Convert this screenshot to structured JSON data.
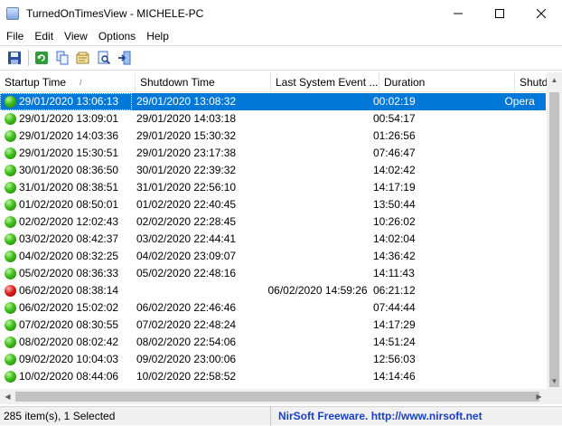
{
  "window": {
    "title": "TurnedOnTimesView  -  MICHELE-PC"
  },
  "menu": [
    "File",
    "Edit",
    "View",
    "Options",
    "Help"
  ],
  "toolbar": {
    "buttons": [
      {
        "name": "save-icon"
      },
      {
        "name": "refresh-icon"
      },
      {
        "name": "copy-icon"
      },
      {
        "name": "properties-icon"
      },
      {
        "name": "find-icon"
      },
      {
        "name": "exit-icon"
      }
    ]
  },
  "columns": [
    "Startup Time",
    "Shutdown Time",
    "Last System Event ...",
    "Duration",
    "Shutdown"
  ],
  "sort_indicator": "/",
  "rows": [
    {
      "startup": "29/01/2020 13:06:13",
      "shutdown": "29/01/2020 13:08:32",
      "event": "",
      "duration": "00:02:19",
      "extra": "Opera",
      "status": "selected"
    },
    {
      "startup": "29/01/2020 13:09:01",
      "shutdown": "29/01/2020 14:03:18",
      "event": "",
      "duration": "00:54:17",
      "extra": "",
      "status": "green"
    },
    {
      "startup": "29/01/2020 14:03:36",
      "shutdown": "29/01/2020 15:30:32",
      "event": "",
      "duration": "01:26:56",
      "extra": "",
      "status": "green"
    },
    {
      "startup": "29/01/2020 15:30:51",
      "shutdown": "29/01/2020 23:17:38",
      "event": "",
      "duration": "07:46:47",
      "extra": "",
      "status": "green"
    },
    {
      "startup": "30/01/2020 08:36:50",
      "shutdown": "30/01/2020 22:39:32",
      "event": "",
      "duration": "14:02:42",
      "extra": "",
      "status": "green"
    },
    {
      "startup": "31/01/2020 08:38:51",
      "shutdown": "31/01/2020 22:56:10",
      "event": "",
      "duration": "14:17:19",
      "extra": "",
      "status": "green"
    },
    {
      "startup": "01/02/2020 08:50:01",
      "shutdown": "01/02/2020 22:40:45",
      "event": "",
      "duration": "13:50:44",
      "extra": "",
      "status": "green"
    },
    {
      "startup": "02/02/2020 12:02:43",
      "shutdown": "02/02/2020 22:28:45",
      "event": "",
      "duration": "10:26:02",
      "extra": "",
      "status": "green"
    },
    {
      "startup": "03/02/2020 08:42:37",
      "shutdown": "03/02/2020 22:44:41",
      "event": "",
      "duration": "14:02:04",
      "extra": "",
      "status": "green"
    },
    {
      "startup": "04/02/2020 08:32:25",
      "shutdown": "04/02/2020 23:09:07",
      "event": "",
      "duration": "14:36:42",
      "extra": "",
      "status": "green"
    },
    {
      "startup": "05/02/2020 08:36:33",
      "shutdown": "05/02/2020 22:48:16",
      "event": "",
      "duration": "14:11:43",
      "extra": "",
      "status": "green"
    },
    {
      "startup": "06/02/2020 08:38:14",
      "shutdown": "",
      "event": "06/02/2020 14:59:26",
      "duration": "06:21:12",
      "extra": "",
      "status": "red"
    },
    {
      "startup": "06/02/2020 15:02:02",
      "shutdown": "06/02/2020 22:46:46",
      "event": "",
      "duration": "07:44:44",
      "extra": "",
      "status": "green"
    },
    {
      "startup": "07/02/2020 08:30:55",
      "shutdown": "07/02/2020 22:48:24",
      "event": "",
      "duration": "14:17:29",
      "extra": "",
      "status": "green"
    },
    {
      "startup": "08/02/2020 08:02:42",
      "shutdown": "08/02/2020 22:54:06",
      "event": "",
      "duration": "14:51:24",
      "extra": "",
      "status": "green"
    },
    {
      "startup": "09/02/2020 10:04:03",
      "shutdown": "09/02/2020 23:00:06",
      "event": "",
      "duration": "12:56:03",
      "extra": "",
      "status": "green"
    },
    {
      "startup": "10/02/2020 08:44:06",
      "shutdown": "10/02/2020 22:58:52",
      "event": "",
      "duration": "14:14:46",
      "extra": "",
      "status": "green"
    }
  ],
  "status": {
    "count": "285 item(s), 1 Selected",
    "link": "NirSoft Freeware.  http://www.nirsoft.net"
  },
  "colors": {
    "selection": "#0078d7",
    "link": "#1a3fc4"
  }
}
